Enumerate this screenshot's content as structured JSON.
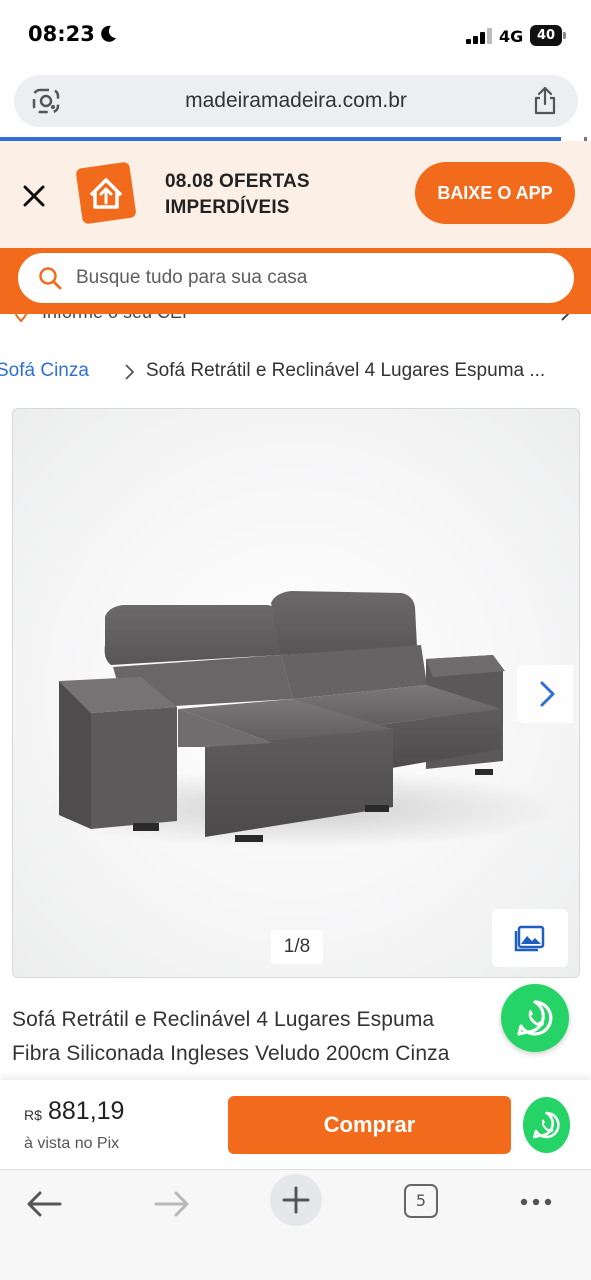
{
  "status_bar": {
    "time": "08:23",
    "network": "4G",
    "battery": "40"
  },
  "browser": {
    "url": "madeiramadeira.com.br",
    "tabs_count": "5"
  },
  "app_banner": {
    "line1": "08.08 OFERTAS",
    "line2": "IMPERDÍVEIS",
    "cta": "BAIXE O APP",
    "accent_color": "#f26a1b"
  },
  "search": {
    "placeholder": "Busque tudo para sua casa"
  },
  "cep": {
    "label": "Informe o seu CEP"
  },
  "breadcrumb": {
    "parent": "Sofá Cinza",
    "current": "Sofá Retrátil e Reclinável 4 Lugares Espuma ..."
  },
  "gallery": {
    "counter": "1/8"
  },
  "product": {
    "title_line1": "Sofá Retrátil e Reclinável 4 Lugares Espuma",
    "title_line2": "Fibra Siliconada Ingleses Veludo 200cm Cinza"
  },
  "buy_bar": {
    "currency": "R$",
    "price": "881,19",
    "price_note": "à vista no Pix",
    "buy_label": "Comprar"
  },
  "icons": {
    "whatsapp_color": "#25d366",
    "link_color": "#2f6fd6"
  }
}
